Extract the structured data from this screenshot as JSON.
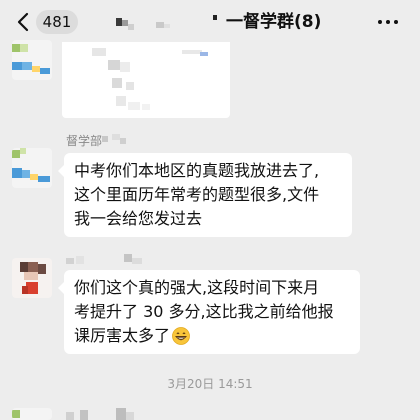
{
  "header": {
    "back_icon": "chevron-left-icon",
    "unread_count": "481",
    "title": "一督学群(8)",
    "more_icon": "more-horizontal-icon"
  },
  "messages": [
    {
      "type": "image"
    },
    {
      "type": "text",
      "sender": "督学部",
      "lines": [
        "中考你们本地区的真题我放进去了,",
        "这个里面历年常考的题型很多,文件",
        "我一会给您发过去"
      ]
    },
    {
      "type": "text",
      "lines": [
        "你们这个真的强大,这段时间下来月",
        "考提升了 30 多分,这比我之前给他报",
        "课厉害太多了"
      ],
      "emoji": "grinning-face-emoji"
    }
  ],
  "timestamp": "3月20日 14:51",
  "colors": {
    "background": "#ededed",
    "bubble": "#ffffff",
    "timestamp": "#9a9a9a",
    "sender": "#888888"
  }
}
